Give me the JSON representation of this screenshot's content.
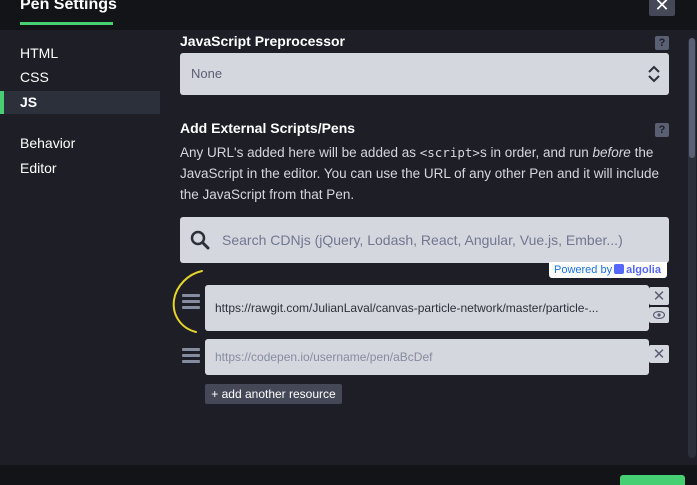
{
  "header": {
    "title": "Pen Settings",
    "close_glyph": "✕",
    "accent_color": "#47cf73"
  },
  "sidebar": {
    "items": [
      {
        "label": "HTML",
        "active": false
      },
      {
        "label": "CSS",
        "active": false
      },
      {
        "label": "JS",
        "active": true
      },
      {
        "label": "Behavior",
        "active": false
      },
      {
        "label": "Editor",
        "active": false
      }
    ]
  },
  "preprocessor": {
    "title": "JavaScript Preprocessor",
    "help": "?",
    "selected": "None"
  },
  "external": {
    "title": "Add External Scripts/Pens",
    "help": "?",
    "desc_part1": "Any URL's added here will be added as ",
    "desc_code": "<script>",
    "desc_part2": "s in order, and run ",
    "desc_em": "before",
    "desc_part3": " the JavaScript in the editor. You can use the URL of any other Pen and it will include the JavaScript from that Pen.",
    "search_placeholder": "Search CDNjs (jQuery, Lodash, React, Angular, Vue.js, Ember...)",
    "powered_by": "Powered by",
    "algolia": "algolia",
    "resources": [
      {
        "value": "https://rawgit.com/JulianLaval/canvas-particle-network/master/particle-..."
      },
      {
        "placeholder": "https://codepen.io/username/pen/aBcDef"
      }
    ],
    "remove_glyph": "✕",
    "add_label": "+ add another resource"
  },
  "icons": [
    "close-icon",
    "help-icon",
    "select-arrows-icon",
    "search-icon",
    "algolia-icon",
    "drag-handle-icon",
    "remove-icon",
    "eye-icon"
  ]
}
